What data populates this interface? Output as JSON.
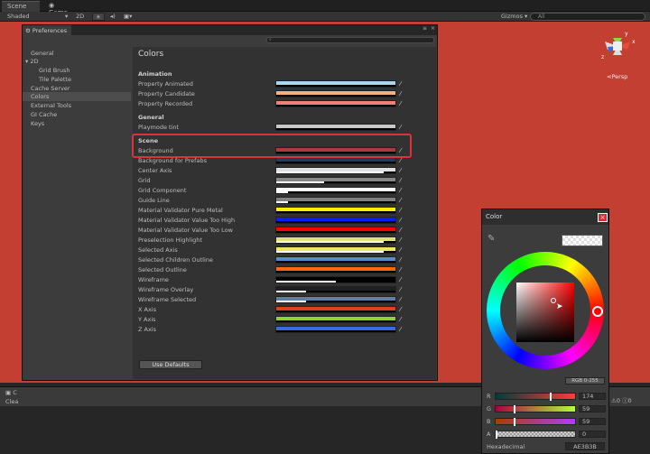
{
  "tabs": {
    "scene": "Scene",
    "game": "Game"
  },
  "toolbar": {
    "shading": "Shaded",
    "mode_2d": "2D",
    "gizmos": "Gizmos",
    "search_placeholder": "All"
  },
  "scene": {
    "view_label": "Persp",
    "background": "#c23f32"
  },
  "prefs": {
    "tab": "Preferences",
    "sidebar": [
      "General",
      "2D",
      "Grid Brush",
      "Tile Palette",
      "Cache Server",
      "Colors",
      "External Tools",
      "GI Cache",
      "Keys"
    ],
    "selected": "Colors",
    "title": "Colors",
    "sections": {
      "animation": "Animation",
      "general": "General",
      "scene": "Scene"
    },
    "animation_rows": [
      {
        "label": "Property Animated",
        "color": "#a8d8f0"
      },
      {
        "label": "Property Candidate",
        "color": "#f5b080"
      },
      {
        "label": "Property Recorded",
        "color": "#f08078"
      }
    ],
    "general_rows": [
      {
        "label": "Playmode tint",
        "color": "#c8c8c8"
      }
    ],
    "scene_rows": [
      {
        "label": "Background",
        "color": "#ae3b3b"
      },
      {
        "label": "Background for Prefabs",
        "color": "#223c5c"
      },
      {
        "label": "Center Axis",
        "color": "#e0e0e0"
      },
      {
        "label": "Grid",
        "color": "#888888"
      },
      {
        "label": "Grid Component",
        "color": "#ffffff"
      },
      {
        "label": "Guide Line",
        "color": "#808080"
      },
      {
        "label": "Material Validator Pure Metal",
        "color": "#ffee00"
      },
      {
        "label": "Material Validator Value Too High",
        "color": "#0020ff"
      },
      {
        "label": "Material Validator Value Too Low",
        "color": "#ff0000"
      },
      {
        "label": "Preselection Highlight",
        "color": "#e0e080"
      },
      {
        "label": "Selected Axis",
        "color": "#f0e860"
      },
      {
        "label": "Selected Children Outline",
        "color": "#5a8acc"
      },
      {
        "label": "Selected Outline",
        "color": "#ff6610"
      },
      {
        "label": "Wireframe",
        "color": "#000000"
      },
      {
        "label": "Wireframe Overlay",
        "color": "#202020"
      },
      {
        "label": "Wireframe Selected",
        "color": "#5e80a8"
      },
      {
        "label": "X Axis",
        "color": "#e04020"
      },
      {
        "label": "Y Axis",
        "color": "#90d040"
      },
      {
        "label": "Z Axis",
        "color": "#3a6ae0"
      }
    ],
    "use_defaults": "Use Defaults"
  },
  "color_window": {
    "title": "Color",
    "mode": "RGB 0-255",
    "channels": [
      {
        "label": "R",
        "value": "174",
        "fraction": 0.68
      },
      {
        "label": "G",
        "value": "59",
        "fraction": 0.23
      },
      {
        "label": "B",
        "value": "59",
        "fraction": 0.23
      },
      {
        "label": "A",
        "value": "0",
        "fraction": 0.0
      }
    ],
    "hex_label": "Hexadecimal",
    "hex_value": "AE3B3B"
  },
  "bottom": {
    "tab_prefix": "C",
    "clear": "Clea",
    "counter_a": "0",
    "counter_b": "0"
  }
}
